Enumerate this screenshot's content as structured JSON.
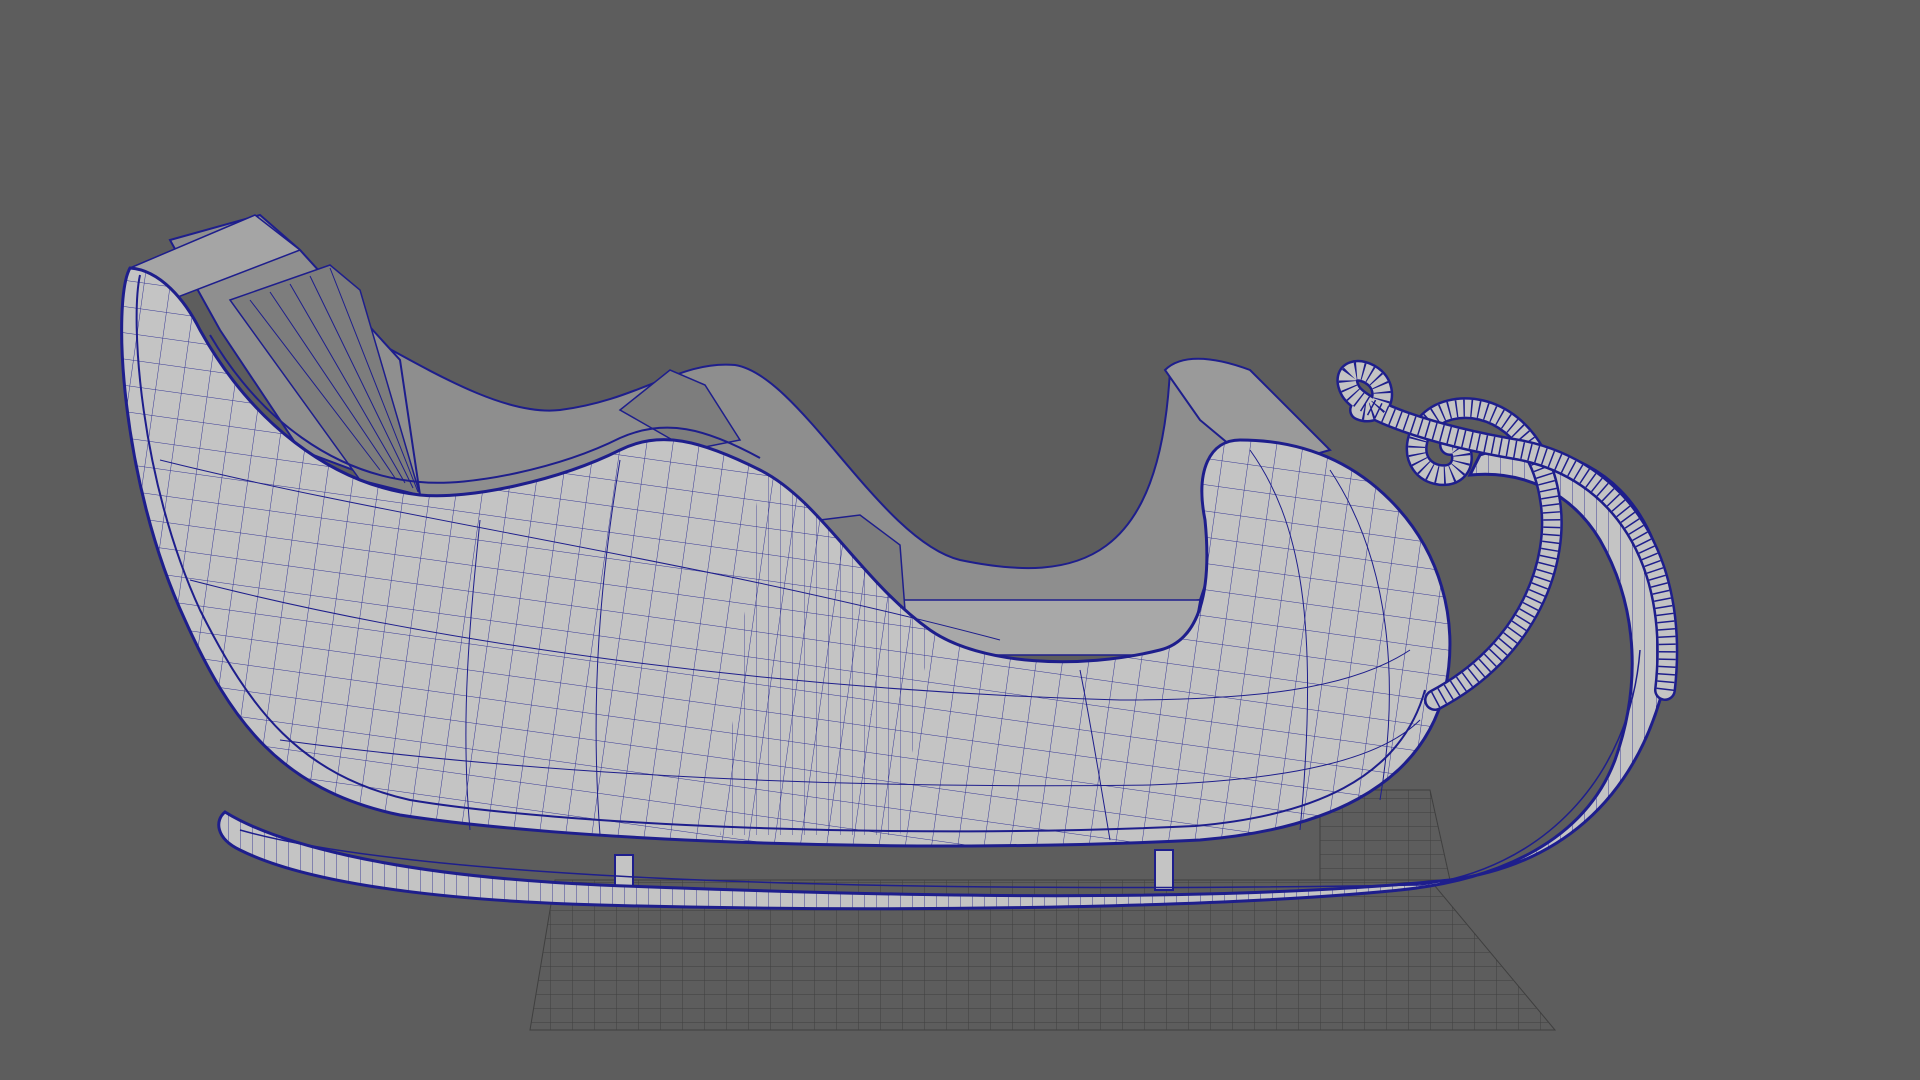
{
  "viewport": {
    "background_color": "#5d5d5d",
    "wire_color": "#1e1e8c",
    "surface_color": "#c4c4c4",
    "interior_color": "#8e8e8e",
    "grid_color": "#3f3f3f",
    "object": "sleigh-mesh",
    "shading": "wireframe-on-shaded",
    "grid_visible": true
  }
}
